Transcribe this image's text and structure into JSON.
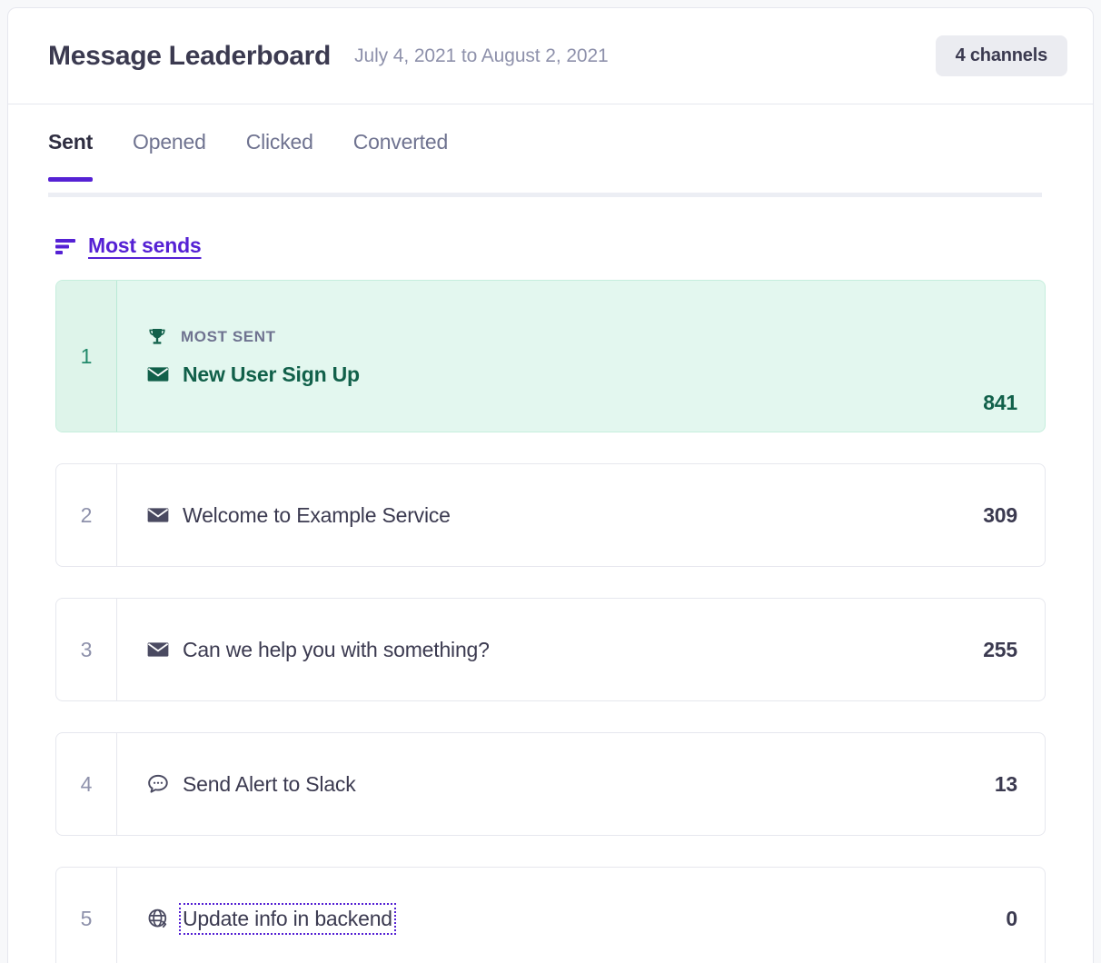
{
  "header": {
    "title": "Message Leaderboard",
    "date_range": "July 4, 2021 to August 2, 2021",
    "channels_badge": "4 channels"
  },
  "tabs": [
    {
      "label": "Sent",
      "active": true
    },
    {
      "label": "Opened",
      "active": false
    },
    {
      "label": "Clicked",
      "active": false
    },
    {
      "label": "Converted",
      "active": false
    }
  ],
  "sort": {
    "icon": "sort-descending-icon",
    "label": "Most sends"
  },
  "leaderboard": {
    "winner_label": "MOST SENT",
    "winner_icon": "trophy-icon",
    "rows": [
      {
        "rank": "1",
        "name": "New User Sign Up",
        "value": "841",
        "channel_icon": "email-icon",
        "winner": true,
        "focused": false
      },
      {
        "rank": "2",
        "name": "Welcome to Example Service",
        "value": "309",
        "channel_icon": "email-icon",
        "winner": false,
        "focused": false
      },
      {
        "rank": "3",
        "name": "Can we help you with something?",
        "value": "255",
        "channel_icon": "email-icon",
        "winner": false,
        "focused": false
      },
      {
        "rank": "4",
        "name": "Send Alert to Slack",
        "value": "13",
        "channel_icon": "chat-bubble-icon",
        "winner": false,
        "focused": false
      },
      {
        "rank": "5",
        "name": "Update info in backend",
        "value": "0",
        "channel_icon": "webhook-globe-icon",
        "winner": false,
        "focused": true
      }
    ]
  },
  "colors": {
    "accent_purple": "#5521d4",
    "winner_green_bg": "#e3f7ef",
    "winner_green_text": "#11604a",
    "text_dark": "#3b3a50",
    "text_muted": "#8e91ab",
    "border": "#e6e7ee"
  }
}
